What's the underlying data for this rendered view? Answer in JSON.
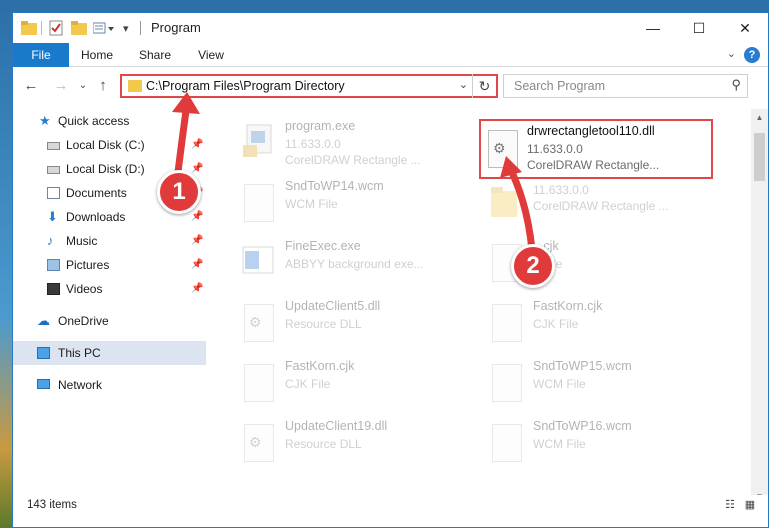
{
  "window": {
    "title": "Program",
    "controls": {
      "minimize": "—",
      "maximize": "☐",
      "close": "✕"
    }
  },
  "ribbon": {
    "tabs": [
      "File",
      "Home",
      "Share",
      "View"
    ]
  },
  "address": {
    "path": "C:\\Program Files\\Program Directory",
    "search_placeholder": "Search Program"
  },
  "sidebar": {
    "quick_access": "Quick access",
    "items": [
      {
        "label": "Local Disk (C:)",
        "icon": "drive-icon",
        "pinned": true
      },
      {
        "label": "Local Disk (D:)",
        "icon": "drive-icon",
        "pinned": true
      },
      {
        "label": "Documents",
        "icon": "documents-icon",
        "pinned": true
      },
      {
        "label": "Downloads",
        "icon": "downloads-icon",
        "pinned": true
      },
      {
        "label": "Music",
        "icon": "music-icon",
        "pinned": true
      },
      {
        "label": "Pictures",
        "icon": "pictures-icon",
        "pinned": true
      },
      {
        "label": "Videos",
        "icon": "videos-icon",
        "pinned": true
      }
    ],
    "onedrive": "OneDrive",
    "this_pc": "This PC",
    "network": "Network"
  },
  "files": [
    {
      "name": "program.exe",
      "line2": "11.633.0.0",
      "line3": "CorelDRAW Rectangle ...",
      "icon": "exe-icon",
      "faded": true
    },
    {
      "name": "drwrectangletool110.dll",
      "line2": "11.633.0.0",
      "line3": "CorelDRAW Rectangle...",
      "icon": "dll-icon",
      "faded": false,
      "highlighted": true
    },
    {
      "name": "SndToWP14.wcm",
      "line2": "WCM File",
      "line3": "",
      "icon": "file-icon",
      "faded": true
    },
    {
      "name": "",
      "line2": "11.633.0.0",
      "line3": "CorelDRAW Rectangle ...",
      "icon": "folder-icon",
      "faded": true
    },
    {
      "name": "FineExec.exe",
      "line2": "ABBYY background exe...",
      "line3": "",
      "icon": "exe-icon",
      "faded": true
    },
    {
      "name": "...cjk",
      "line2": "...File",
      "line3": "",
      "icon": "file-icon",
      "faded": true
    },
    {
      "name": "UpdateClient5.dll",
      "line2": "Resource DLL",
      "line3": "",
      "icon": "dll-icon",
      "faded": true
    },
    {
      "name": "FastKorn.cjk",
      "line2": "CJK File",
      "line3": "",
      "icon": "file-icon",
      "faded": true
    },
    {
      "name": "FastKorn.cjk",
      "line2": "CJK File",
      "line3": "",
      "icon": "file-icon",
      "faded": true
    },
    {
      "name": "SndToWP15.wcm",
      "line2": "WCM File",
      "line3": "",
      "icon": "file-icon",
      "faded": true
    },
    {
      "name": "UpdateClient19.dll",
      "line2": "Resource DLL",
      "line3": "",
      "icon": "dll-icon",
      "faded": true
    },
    {
      "name": "SndToWP16.wcm",
      "line2": "WCM File",
      "line3": "",
      "icon": "file-icon",
      "faded": true
    }
  ],
  "status": {
    "count": "143 items"
  },
  "annotations": {
    "step1": "1",
    "step2": "2"
  },
  "colors": {
    "accent": "#1979ca",
    "highlight": "#e04848",
    "annotation": "#e03a3a"
  }
}
